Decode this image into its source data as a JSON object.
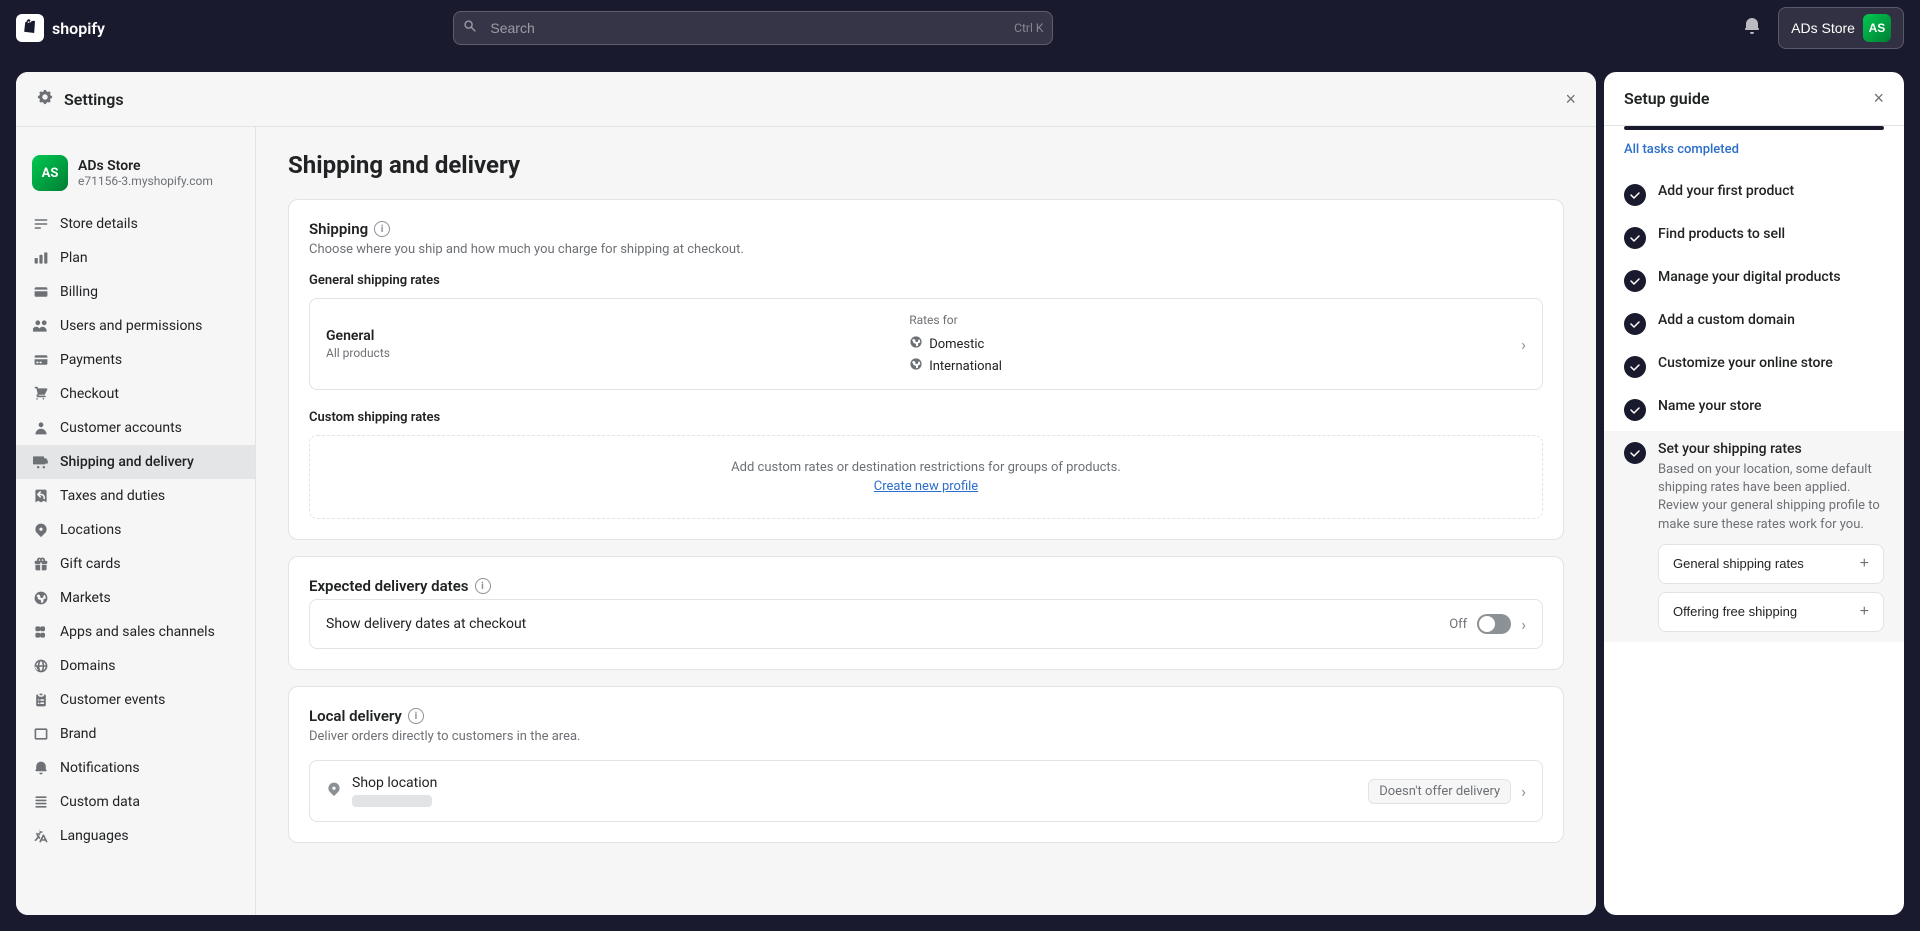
{
  "topnav": {
    "logo_text": "shopify",
    "search_placeholder": "Search",
    "search_shortcut": "Ctrl K",
    "store_name": "ADs Store",
    "avatar_initials": "AS",
    "bell_icon": "bell"
  },
  "settings_modal": {
    "title": "Settings",
    "close_label": "×",
    "store": {
      "name": "ADs Store",
      "domain": "e71156-3.myshopify.com",
      "initials": "AS"
    },
    "nav": [
      {
        "id": "store-details",
        "label": "Store details",
        "icon": "store"
      },
      {
        "id": "plan",
        "label": "Plan",
        "icon": "plan"
      },
      {
        "id": "billing",
        "label": "Billing",
        "icon": "billing"
      },
      {
        "id": "users",
        "label": "Users and permissions",
        "icon": "users"
      },
      {
        "id": "payments",
        "label": "Payments",
        "icon": "payments"
      },
      {
        "id": "checkout",
        "label": "Checkout",
        "icon": "checkout"
      },
      {
        "id": "customer-accounts",
        "label": "Customer accounts",
        "icon": "customer"
      },
      {
        "id": "shipping",
        "label": "Shipping and delivery",
        "icon": "shipping",
        "active": true
      },
      {
        "id": "taxes",
        "label": "Taxes and duties",
        "icon": "taxes"
      },
      {
        "id": "locations",
        "label": "Locations",
        "icon": "location"
      },
      {
        "id": "gift-cards",
        "label": "Gift cards",
        "icon": "gift"
      },
      {
        "id": "markets",
        "label": "Markets",
        "icon": "markets"
      },
      {
        "id": "apps-channels",
        "label": "Apps and sales channels",
        "icon": "apps"
      },
      {
        "id": "domains",
        "label": "Domains",
        "icon": "domains"
      },
      {
        "id": "customer-events",
        "label": "Customer events",
        "icon": "events"
      },
      {
        "id": "brand",
        "label": "Brand",
        "icon": "brand"
      },
      {
        "id": "notifications",
        "label": "Notifications",
        "icon": "notifications"
      },
      {
        "id": "custom-data",
        "label": "Custom data",
        "icon": "custom"
      },
      {
        "id": "languages",
        "label": "Languages",
        "icon": "languages"
      }
    ]
  },
  "shipping_page": {
    "title": "Shipping and delivery",
    "shipping_section": {
      "title": "Shipping",
      "subtitle": "Choose where you ship and how much you charge for shipping at checkout.",
      "general_rates_label": "General shipping rates",
      "rate_type": "General",
      "rate_desc": "All products",
      "rates_for_label": "Rates for",
      "domestic_label": "Domestic",
      "international_label": "International",
      "custom_rates_label": "Custom shipping rates",
      "custom_rates_placeholder": "Add custom rates or destination restrictions for groups of products.",
      "create_link": "Create new profile"
    },
    "delivery_dates_section": {
      "title": "Expected delivery dates",
      "toggle_label": "Show delivery dates at checkout",
      "toggle_status": "Off"
    },
    "local_delivery_section": {
      "title": "Local delivery",
      "subtitle": "Deliver orders directly to customers in the area.",
      "shop_location_name": "Shop location",
      "delivery_status": "Doesn't offer delivery"
    }
  },
  "setup_guide": {
    "title": "Setup guide",
    "close_label": "×",
    "all_tasks_label": "All tasks completed",
    "progress": 100,
    "tasks": [
      {
        "id": "first-product",
        "label": "Add your first product",
        "completed": true,
        "active": false
      },
      {
        "id": "find-products",
        "label": "Find products to sell",
        "completed": true,
        "active": false
      },
      {
        "id": "digital-products",
        "label": "Manage your digital products",
        "completed": true,
        "active": false
      },
      {
        "id": "custom-domain",
        "label": "Add a custom domain",
        "completed": true,
        "active": false
      },
      {
        "id": "customize-store",
        "label": "Customize your online store",
        "completed": true,
        "active": false
      },
      {
        "id": "name-store",
        "label": "Name your store",
        "completed": true,
        "active": false
      },
      {
        "id": "shipping-rates",
        "label": "Set your shipping rates",
        "completed": true,
        "active": true,
        "description": "Based on your location, some default shipping rates have been applied. Review your general shipping profile to make sure these rates work for you.",
        "actions": [
          {
            "id": "general-rates",
            "label": "General shipping rates"
          },
          {
            "id": "free-shipping",
            "label": "Offering free shipping"
          }
        ]
      }
    ]
  }
}
